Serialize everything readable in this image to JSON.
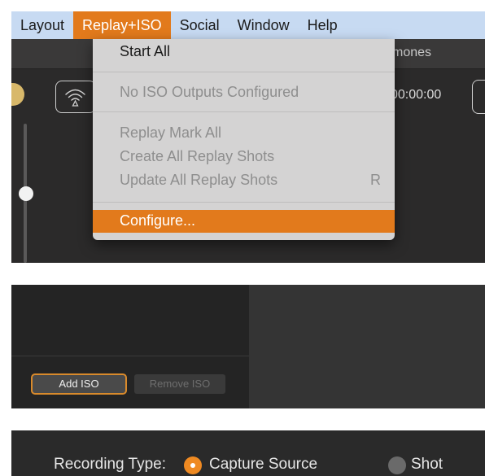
{
  "menubar": {
    "items": [
      {
        "label": "Layout"
      },
      {
        "label": "Replay+ISO",
        "active": true
      },
      {
        "label": "Social"
      },
      {
        "label": "Window"
      },
      {
        "label": "Help"
      }
    ]
  },
  "toolbar": {
    "right_text": "mones",
    "timecode": "00:00:00"
  },
  "dropdown": {
    "items": [
      {
        "label": "Start All",
        "enabled": true
      },
      {
        "label": "No ISO Outputs Configured",
        "enabled": false
      },
      {
        "label": "Replay Mark All",
        "enabled": false
      },
      {
        "label": "Create All Replay Shots",
        "enabled": false
      },
      {
        "label": "Update All Replay Shots",
        "enabled": false,
        "shortcut": "R"
      },
      {
        "label": "Configure...",
        "enabled": true,
        "highlighted": true
      }
    ]
  },
  "iso_panel": {
    "add_label": "Add ISO",
    "remove_label": "Remove ISO"
  },
  "recording": {
    "label": "Recording Type:",
    "options": [
      {
        "label": "Capture Source",
        "selected": true
      },
      {
        "label": "Shot",
        "selected": false
      }
    ]
  },
  "colors": {
    "accent": "#e27a1c",
    "menubar": "#c7daf2",
    "menu_bg": "#d4d3d3"
  }
}
